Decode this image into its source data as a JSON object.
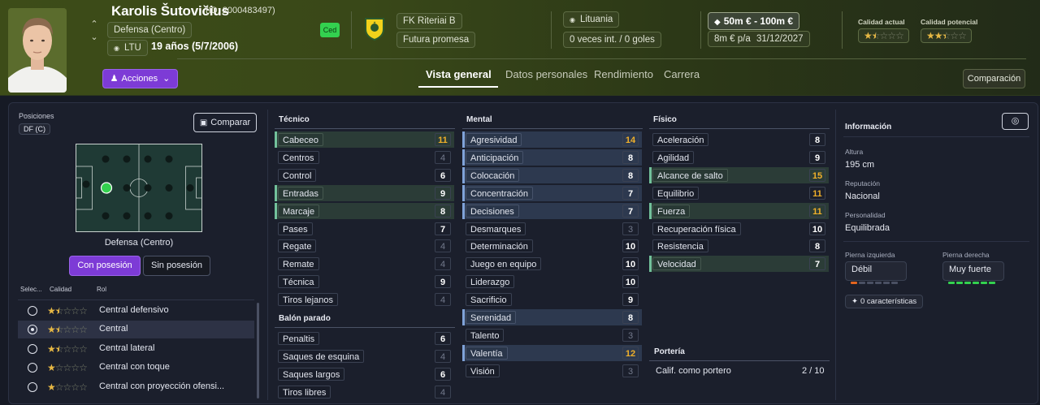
{
  "player": {
    "name": "Karolis Šutovičius",
    "id": "(ID: 2000483497)",
    "position": "Defensa (Centro)",
    "nation": "LTU",
    "age": "19 años (5/7/2006)",
    "status_badge": "Ced"
  },
  "club": {
    "name": "FK Riteriai B",
    "status": "Futura promesa"
  },
  "country": {
    "name": "Lituania",
    "caps": "0 veces int. / 0 goles"
  },
  "value": {
    "range": "50m € - 100m €",
    "wage": "8m € p/a",
    "contract_end": "31/12/2027"
  },
  "quality": {
    "current_label": "Calidad actual",
    "current_stars": 1.5,
    "potential_label": "Calidad potencial",
    "potential_stars": 2.5
  },
  "actions_label": "Acciones",
  "tabs": [
    "Vista general",
    "Datos personales",
    "Rendimiento",
    "Carrera"
  ],
  "compare_button": "Comparación",
  "positions": {
    "title": "Posiciones",
    "tag": "DF (C)",
    "compare": "Comparar",
    "label": "Defensa (Centro)",
    "toggle": [
      "Con posesión",
      "Sin posesión"
    ],
    "table_headers": [
      "Selec...",
      "Calidad",
      "Rol"
    ],
    "roles": [
      {
        "name": "Central defensivo",
        "stars": 1.5,
        "selected": false
      },
      {
        "name": "Central",
        "stars": 1.5,
        "selected": true
      },
      {
        "name": "Central lateral",
        "stars": 1.5,
        "selected": false
      },
      {
        "name": "Central con toque",
        "stars": 1,
        "selected": false
      },
      {
        "name": "Central con proyección ofensi...",
        "stars": 1,
        "selected": false
      }
    ]
  },
  "attributes": {
    "tecnico": {
      "title": "Técnico",
      "items": [
        {
          "name": "Cabeceo",
          "value": 11,
          "hl": true
        },
        {
          "name": "Centros",
          "value": 4,
          "hl": false
        },
        {
          "name": "Control",
          "value": 6,
          "hl": false
        },
        {
          "name": "Entradas",
          "value": 9,
          "hl": true
        },
        {
          "name": "Marcaje",
          "value": 8,
          "hl": true
        },
        {
          "name": "Pases",
          "value": 7,
          "hl": false
        },
        {
          "name": "Regate",
          "value": 4,
          "hl": false
        },
        {
          "name": "Remate",
          "value": 4,
          "hl": false
        },
        {
          "name": "Técnica",
          "value": 9,
          "hl": false
        },
        {
          "name": "Tiros lejanos",
          "value": 4,
          "hl": false
        }
      ]
    },
    "balon_parado": {
      "title": "Balón parado",
      "items": [
        {
          "name": "Penaltis",
          "value": 6,
          "hl": false
        },
        {
          "name": "Saques de esquina",
          "value": 4,
          "hl": false
        },
        {
          "name": "Saques largos",
          "value": 6,
          "hl": false
        },
        {
          "name": "Tiros libres",
          "value": 4,
          "hl": false
        }
      ]
    },
    "mental": {
      "title": "Mental",
      "items": [
        {
          "name": "Agresividad",
          "value": 14,
          "hl": true
        },
        {
          "name": "Anticipación",
          "value": 8,
          "hl": true
        },
        {
          "name": "Colocación",
          "value": 8,
          "hl": true
        },
        {
          "name": "Concentración",
          "value": 7,
          "hl": true
        },
        {
          "name": "Decisiones",
          "value": 7,
          "hl": true
        },
        {
          "name": "Desmarques",
          "value": 3,
          "hl": false
        },
        {
          "name": "Determinación",
          "value": 10,
          "hl": false
        },
        {
          "name": "Juego en equipo",
          "value": 10,
          "hl": false
        },
        {
          "name": "Liderazgo",
          "value": 10,
          "hl": false
        },
        {
          "name": "Sacrificio",
          "value": 9,
          "hl": false
        },
        {
          "name": "Serenidad",
          "value": 8,
          "hl": true
        },
        {
          "name": "Talento",
          "value": 3,
          "hl": false
        },
        {
          "name": "Valentía",
          "value": 12,
          "hl": true
        },
        {
          "name": "Visión",
          "value": 3,
          "hl": false
        }
      ]
    },
    "fisico": {
      "title": "Físico",
      "items": [
        {
          "name": "Aceleración",
          "value": 8,
          "hl": false
        },
        {
          "name": "Agilidad",
          "value": 9,
          "hl": false
        },
        {
          "name": "Alcance de salto",
          "value": 15,
          "hl": true
        },
        {
          "name": "Equilibrio",
          "value": 11,
          "hl": false
        },
        {
          "name": "Fuerza",
          "value": 11,
          "hl": true
        },
        {
          "name": "Recuperación física",
          "value": 10,
          "hl": false
        },
        {
          "name": "Resistencia",
          "value": 8,
          "hl": false
        },
        {
          "name": "Velocidad",
          "value": 7,
          "hl": true
        }
      ]
    },
    "porteria": {
      "title": "Portería",
      "label": "Calif. como portero",
      "value": "2 / 10"
    }
  },
  "info": {
    "title": "Información",
    "height_label": "Altura",
    "height": "195 cm",
    "reputation_label": "Reputación",
    "reputation": "Nacional",
    "personality_label": "Personalidad",
    "personality": "Equilibrada",
    "left_foot_label": "Pierna izquierda",
    "left_foot": "Débil",
    "left_foot_level": 1,
    "right_foot_label": "Pierna derecha",
    "right_foot": "Muy fuerte",
    "right_foot_level": 5,
    "traits": "0 características"
  },
  "colors": {
    "accent": "#7d3bd6",
    "highlight": "#2b3c37",
    "gold": "#f0b02a",
    "green": "#33d14f"
  }
}
